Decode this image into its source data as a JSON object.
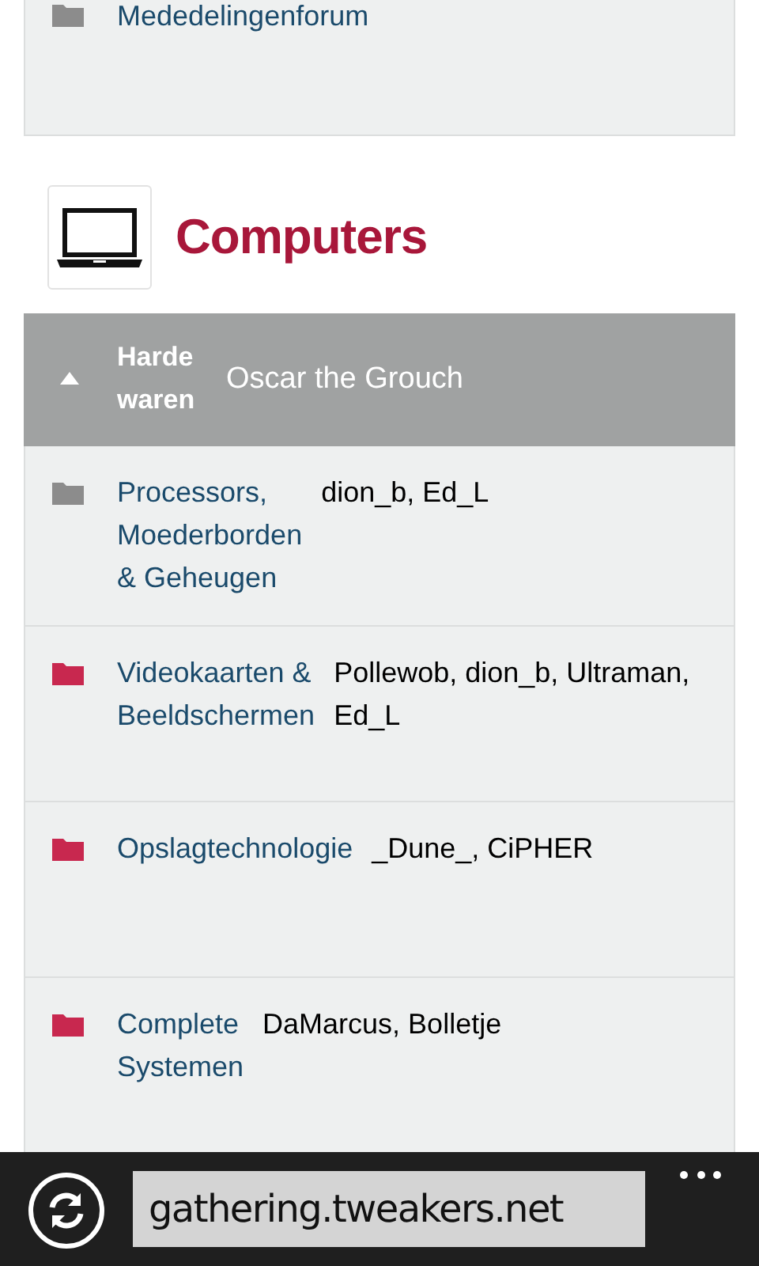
{
  "previous_forum": {
    "name": "Mededelingenforum",
    "unread": false
  },
  "section": {
    "title": "Computers"
  },
  "header": {
    "title": "Harde waren",
    "moderator": "Oscar the Grouch"
  },
  "forums": [
    {
      "name": "Processors, Moederborden & Geheugen",
      "moderators": "dion_b, Ed_L",
      "unread": false
    },
    {
      "name": "Videokaarten & Beeldschermen",
      "moderators": "Pollewob, dion_b, Ultraman, Ed_L",
      "unread": true
    },
    {
      "name": "Opslagtechnologie",
      "moderators": "_Dune_, CiPHER",
      "unread": true
    },
    {
      "name": "Complete Systemen",
      "moderators": "DaMarcus, Bolletje",
      "unread": true
    }
  ],
  "address_bar": {
    "url": "gathering.tweakers.net"
  }
}
